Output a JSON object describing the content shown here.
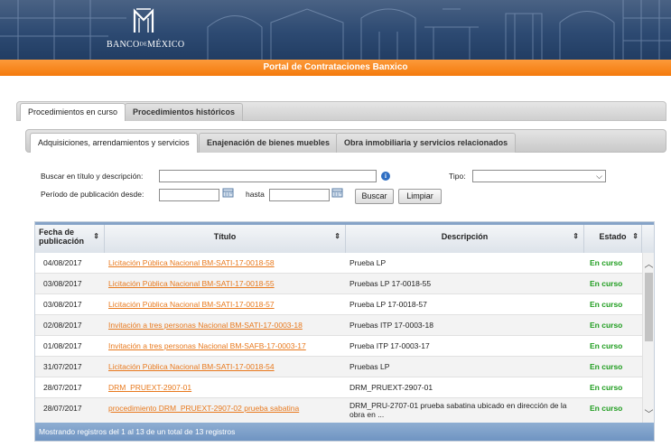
{
  "brand": {
    "name_left": "BANCO",
    "name_small": "DE",
    "name_right": "MÉXICO"
  },
  "portal_title": "Portal de Contrataciones Banxico",
  "outer_tabs": [
    {
      "label": "Procedimientos en curso",
      "active": true
    },
    {
      "label": "Procedimientos históricos",
      "active": false
    }
  ],
  "inner_tabs": [
    {
      "label": "Adquisiciones, arrendamientos y servicios",
      "active": true
    },
    {
      "label": "Enajenación de bienes muebles",
      "active": false
    },
    {
      "label": "Obra inmobiliaria y servicios relacionados",
      "active": false
    }
  ],
  "search": {
    "title_label": "Buscar en título y descripción:",
    "title_value": "",
    "type_label": "Tipo:",
    "type_value": "",
    "period_label": "Período de publicación desde:",
    "from_value": "",
    "until_label": "hasta",
    "until_value": "",
    "search_button": "Buscar",
    "clear_button": "Limpiar"
  },
  "table": {
    "headers": {
      "date": "Fecha de publicación",
      "date_line1": "Fecha de",
      "date_line2": "publicación",
      "title": "Título",
      "description": "Descripción",
      "status": "Estado"
    },
    "rows": [
      {
        "date": "04/08/2017",
        "title": "Licitación Pública Nacional BM-SATI-17-0018-58",
        "description": "Prueba LP",
        "status": "En curso"
      },
      {
        "date": "03/08/2017",
        "title": "Licitación Pública Nacional BM-SATI-17-0018-55",
        "description": "Pruebas LP 17-0018-55",
        "status": "En curso"
      },
      {
        "date": "03/08/2017",
        "title": "Licitación Pública Nacional BM-SATI-17-0018-57",
        "description": "Prueba LP 17-0018-57",
        "status": "En curso"
      },
      {
        "date": "02/08/2017",
        "title": "Invitación a tres personas Nacional BM-SATI-17-0003-18",
        "description": "Pruebas ITP 17-0003-18",
        "status": "En curso"
      },
      {
        "date": "01/08/2017",
        "title": "Invitación a tres personas Nacional BM-SAFB-17-0003-17",
        "description": "Prueba ITP 17-0003-17",
        "status": "En curso"
      },
      {
        "date": "31/07/2017",
        "title": "Licitación Pública Nacional BM-SATI-17-0018-54",
        "description": "Pruebas LP",
        "status": "En curso"
      },
      {
        "date": "28/07/2017",
        "title": "DRM_PRUEXT-2907-01",
        "description": "DRM_PRUEXT-2907-01",
        "status": "En curso"
      },
      {
        "date": "28/07/2017",
        "title": "procedimiento DRM_PRUEXT-2907-02 prueba sabatina",
        "description": "DRM_PRU-2707-01 prueba sabatina ubicado en dirección de la obra en ...",
        "status": "En curso"
      }
    ],
    "footer": "Mostrando registros del 1 al 13 de un total de 13 registros"
  },
  "colors": {
    "orange": "#f47a0c",
    "link": "#e8791d",
    "status": "#1f9d1f",
    "header_blue": "#2d4a72"
  }
}
